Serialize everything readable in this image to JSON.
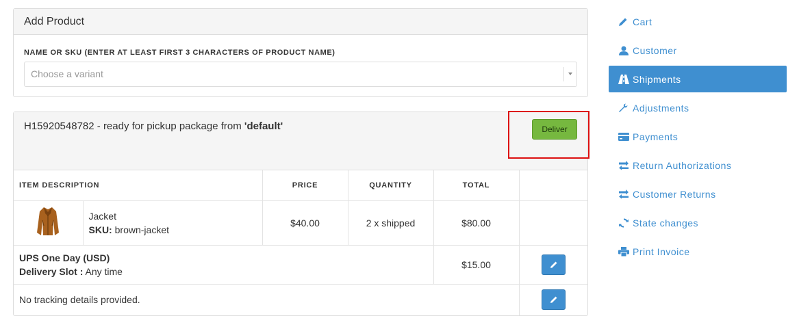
{
  "add_product": {
    "title": "Add Product",
    "field_label": "NAME OR SKU (ENTER AT LEAST FIRST 3 CHARACTERS OF PRODUCT NAME)",
    "placeholder": "Choose a variant"
  },
  "shipment": {
    "number": "H15920548782",
    "status_text": " - ready for pickup package from ",
    "stock_location": "'default'",
    "deliver_label": "Deliver",
    "columns": [
      "ITEM DESCRIPTION",
      "PRICE",
      "QUANTITY",
      "TOTAL"
    ],
    "item": {
      "name": "Jacket",
      "sku_label": "SKU:",
      "sku": "brown-jacket",
      "price": "$40.00",
      "quantity": "2 x shipped",
      "total": "$80.00"
    },
    "method": {
      "name": "UPS One Day (USD)",
      "slot_label": "Delivery Slot :",
      "slot_value": "Any time",
      "cost": "$15.00"
    },
    "tracking": "No tracking details provided."
  },
  "sidebar": {
    "items": [
      {
        "label": "Cart",
        "icon": "pencil-icon"
      },
      {
        "label": "Customer",
        "icon": "user-icon"
      },
      {
        "label": "Shipments",
        "icon": "road-icon",
        "active": true
      },
      {
        "label": "Adjustments",
        "icon": "wrench-icon"
      },
      {
        "label": "Payments",
        "icon": "credit-card-icon"
      },
      {
        "label": "Return Authorizations",
        "icon": "transfer-icon"
      },
      {
        "label": "Customer Returns",
        "icon": "transfer-icon"
      },
      {
        "label": "State changes",
        "icon": "refresh-icon"
      },
      {
        "label": "Print Invoice",
        "icon": "print-icon"
      }
    ]
  },
  "colors": {
    "accent": "#3f8fd0",
    "deliver_button": "#76b83f",
    "highlight": "#dd1111"
  }
}
